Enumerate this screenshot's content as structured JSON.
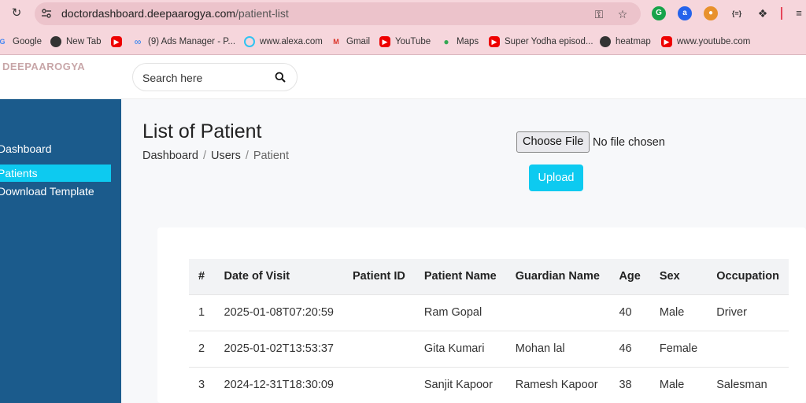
{
  "browser": {
    "url_host": "doctordashboard.deepaarogya.com",
    "url_path": "/patient-list",
    "bookmarks": [
      {
        "label": "Google",
        "icon": "google-icon"
      },
      {
        "label": "New Tab",
        "icon": "globe-icon"
      },
      {
        "label": "",
        "icon": "youtube-icon"
      },
      {
        "label": "(9) Ads Manager - P...",
        "icon": "meta-icon"
      },
      {
        "label": "www.alexa.com",
        "icon": "alexa-icon"
      },
      {
        "label": "Gmail",
        "icon": "gmail-icon"
      },
      {
        "label": "YouTube",
        "icon": "youtube-icon"
      },
      {
        "label": "Maps",
        "icon": "maps-icon"
      },
      {
        "label": "Super Yodha episod...",
        "icon": "youtube-icon"
      },
      {
        "label": "heatmap",
        "icon": "globe-icon"
      },
      {
        "label": "www.youtube.com",
        "icon": "youtube-icon"
      }
    ]
  },
  "app": {
    "logo": "DEEPAAROGYA",
    "search_placeholder": "Search here"
  },
  "sidebar": {
    "items": [
      {
        "label": "Dashboard",
        "active": false
      },
      {
        "label": "Patients",
        "active": true
      },
      {
        "label": "Download Template",
        "active": false
      }
    ]
  },
  "main": {
    "title": "List of Patient",
    "breadcrumb": [
      "Dashboard",
      "Users",
      "Patient"
    ],
    "choose_file": "Choose File",
    "file_status": "No file chosen",
    "upload": "Upload"
  },
  "table": {
    "headers": [
      "#",
      "Date of Visit",
      "Patient ID",
      "Patient Name",
      "Guardian Name",
      "Age",
      "Sex",
      "Occupation"
    ],
    "rows": [
      [
        "1",
        "2025-01-08T07:20:59",
        "",
        "Ram Gopal",
        "",
        "40",
        "Male",
        "Driver"
      ],
      [
        "2",
        "2025-01-02T13:53:37",
        "",
        "Gita Kumari",
        "Mohan lal",
        "46",
        "Female",
        ""
      ],
      [
        "3",
        "2024-12-31T18:30:09",
        "",
        "Sanjit Kapoor",
        "Ramesh Kapoor",
        "38",
        "Male",
        "Salesman"
      ]
    ]
  },
  "colors": {
    "accent": "#0dcaf0",
    "sidebar": "#1b5b8c",
    "chrome": "#f6d6dc"
  }
}
